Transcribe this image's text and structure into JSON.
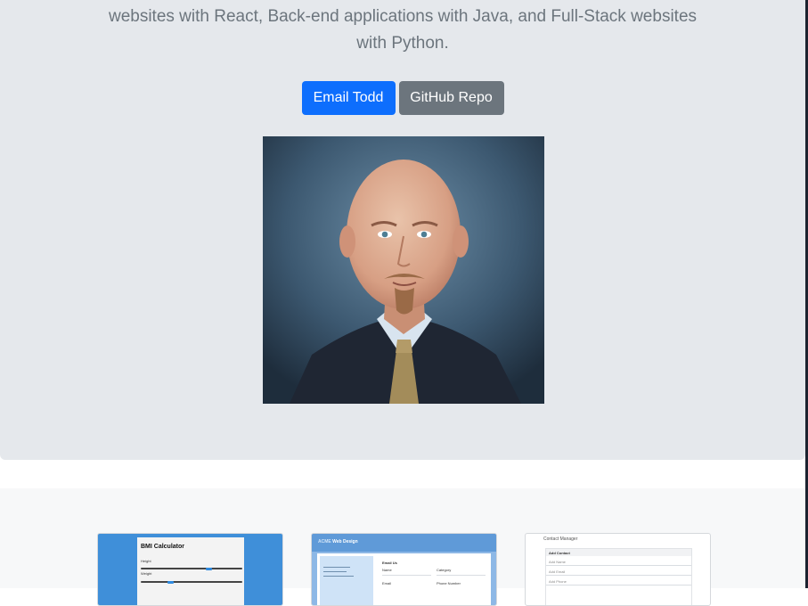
{
  "hero": {
    "lead_line_1": "websites with React, Back-end applications with Java, and Full-Stack websites",
    "lead_line_2": "with Python.",
    "email_button": "Email Todd",
    "repo_button": "GitHub Repo",
    "photo_icon": "portrait-photo"
  },
  "projects": {
    "cards": [
      {
        "title": "BMI Calculator",
        "height_label": "Height",
        "weight_label": "Weight",
        "height_slider_level": 0.68,
        "weight_slider_level": 0.28
      },
      {
        "brand_accent": "ACME",
        "brand_rest": "Web Design",
        "form_title": "Email Us",
        "field_name": "Name",
        "field_category": "Category",
        "field_email": "Email",
        "field_phone": "Phone Number"
      },
      {
        "title": "Contact Manager",
        "panel_title": "Add Contact",
        "field_name": "Add Name",
        "field_email": "Add Email",
        "field_phone": "Add Phone"
      }
    ]
  },
  "colors": {
    "primary": "#0d6efd",
    "secondary": "#6c757d",
    "jumbotron_bg": "#e5e8ec"
  }
}
